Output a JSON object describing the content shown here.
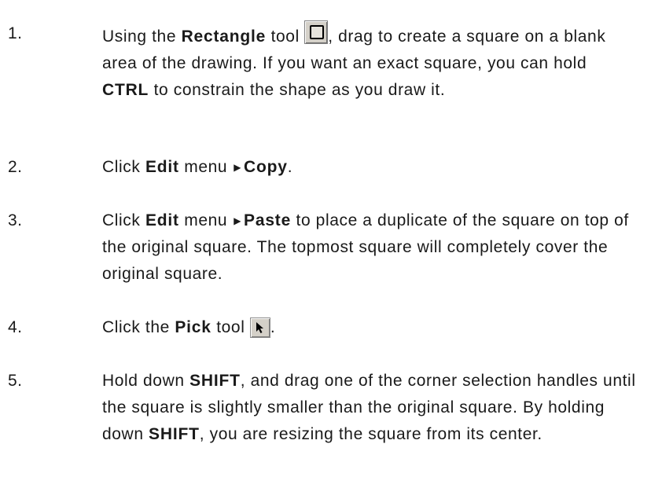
{
  "steps": [
    {
      "number": "1.",
      "parts": {
        "a": "Using the ",
        "b": "Rectangle",
        "c": " tool ",
        "d": ", drag to create a square on a blank area of the drawing. If you want an exact square, you can hold ",
        "e": "CTRL",
        "f": " to constrain the shape as you draw it."
      },
      "icon": "rectangle-tool-icon"
    },
    {
      "number": "2.",
      "parts": {
        "a": "Click ",
        "b": "Edit",
        "c": " menu",
        "arrow": "▶",
        "d": "Copy",
        "e": "."
      }
    },
    {
      "number": "3.",
      "parts": {
        "a": "Click ",
        "b": "Edit",
        "c": " menu",
        "arrow": "▶",
        "d": "Paste",
        "e": " to place a duplicate of the square on top of the original square. The topmost square will completely cover the original square."
      }
    },
    {
      "number": "4.",
      "parts": {
        "a": "Click the ",
        "b": "Pick",
        "c": " tool ",
        "d": "."
      },
      "icon": "pick-tool-icon"
    },
    {
      "number": "5.",
      "parts": {
        "a": "Hold down ",
        "b": "SHIFT",
        "c": ", and drag one of the corner selection handles until the square is slightly smaller than the original square. By holding down ",
        "d": "SHIFT",
        "e": ", you are resizing the square from its center."
      }
    }
  ]
}
